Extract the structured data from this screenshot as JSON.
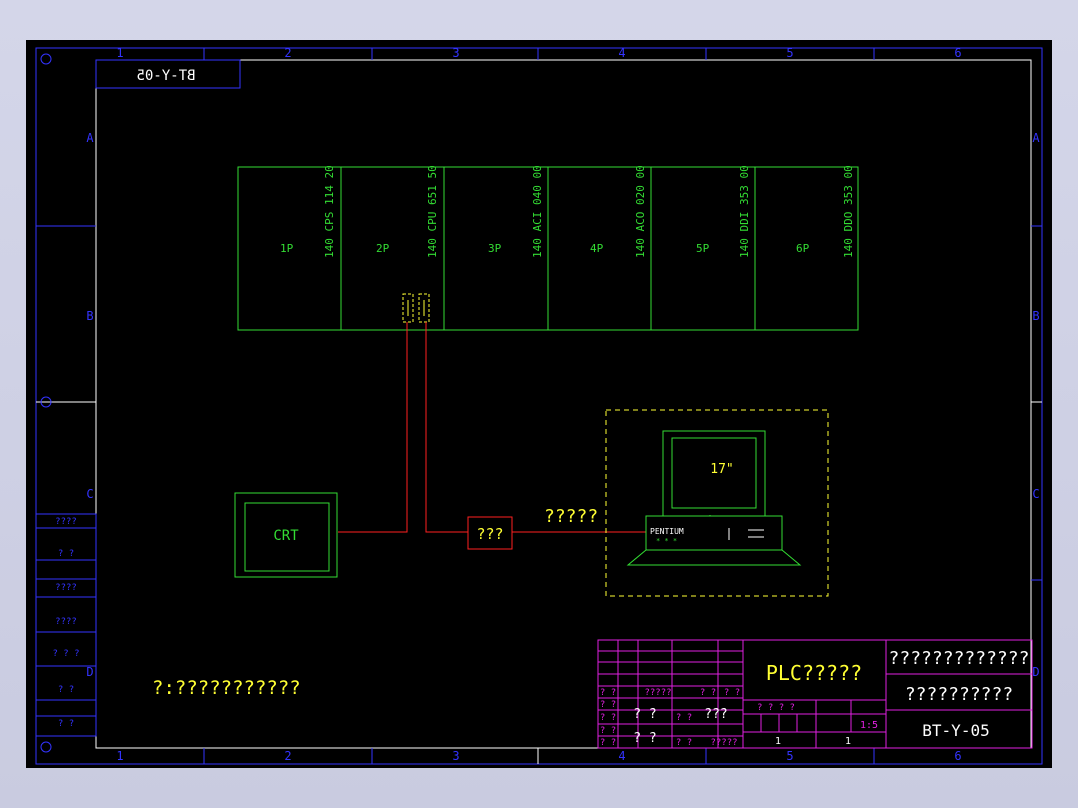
{
  "drawing": {
    "border_columns": [
      "1",
      "2",
      "3",
      "4",
      "5",
      "6"
    ],
    "border_rows": [
      "A",
      "B",
      "C",
      "D"
    ],
    "stamp_mirrored": "BT-Y-05",
    "left_strip_labels": [
      "????",
      "? ?",
      "????",
      "????",
      "? ? ?",
      "? ?",
      "? ?"
    ],
    "colors": {
      "background": "#000000",
      "frame": "#3333ff",
      "modules": "#33dd33",
      "connection": "#ff2020",
      "highlight": "#ffff33",
      "title_block": "#e020e0",
      "text": "#ffffff"
    }
  },
  "plc_rack": {
    "slots": [
      {
        "pos": "1P",
        "model": "140 CPS 114 20"
      },
      {
        "pos": "2P",
        "model": "140 CPU 651 50"
      },
      {
        "pos": "3P",
        "model": "140 ACI 040 00"
      },
      {
        "pos": "4P",
        "model": "140 ACO 020 00"
      },
      {
        "pos": "5P",
        "model": "140 DDI 353 00"
      },
      {
        "pos": "6P",
        "model": "140 DDO 353 00"
      }
    ]
  },
  "devices": {
    "crt_label": "CRT",
    "converter_label": "???",
    "workstation_label": "?????",
    "monitor_size": "17\"",
    "cpu_brand": "PENTIUM",
    "cpu_dots": "* * *"
  },
  "note": "?:???????????",
  "title_block": {
    "project_title": "PLC?????",
    "subtitle_1": "?????????????",
    "subtitle_2": "??????????",
    "drawing_number": "BT-Y-05",
    "row_labels_a": [
      "? ?",
      "?????",
      "? ?",
      "? ?"
    ],
    "cell_1": "? ?",
    "cell_2": "???",
    "cell_3": "? ?",
    "cell_4": "?????",
    "scale_label": "? ? ? ?",
    "scale_value": "1:5",
    "sheet_label": "1",
    "sheet_value": "1",
    "small_texts": [
      "? ?",
      "? ?",
      "? ?",
      "? ?",
      "? ?",
      "? ?"
    ],
    "date_text": "?????"
  }
}
